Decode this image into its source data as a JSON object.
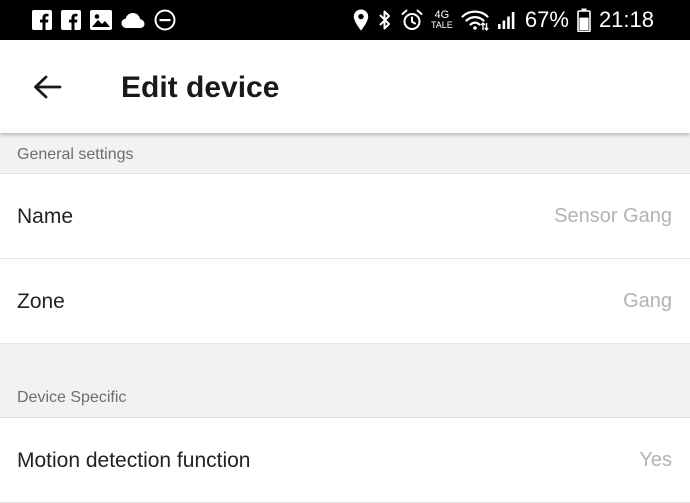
{
  "status_bar": {
    "left_icons": [
      "facebook-icon",
      "facebook-icon",
      "image-icon",
      "cloud-icon",
      "do-not-disturb-icon"
    ],
    "right_icons": [
      "location-icon",
      "bluetooth-icon",
      "alarm-icon",
      "wifi-icon",
      "signal-icon",
      "battery-icon"
    ],
    "network_top": "4G",
    "network_bottom": "TALE",
    "battery_percent": "67%",
    "time": "21:18"
  },
  "app_bar": {
    "back_icon": "back-arrow-icon",
    "title": "Edit device"
  },
  "sections": [
    {
      "header": "General settings",
      "rows": [
        {
          "label": "Name",
          "value": "Sensor Gang"
        },
        {
          "label": "Zone",
          "value": "Gang"
        }
      ]
    },
    {
      "header": "Device Specific",
      "rows": [
        {
          "label": "Motion detection function",
          "value": "Yes"
        }
      ]
    }
  ],
  "colors": {
    "status_bar_bg": "#000000",
    "app_bar_bg": "#ffffff",
    "page_bg": "#f2f2f2",
    "row_bg": "#ffffff",
    "value_text": "#b3b3b3",
    "header_text": "#6e6e6e"
  }
}
